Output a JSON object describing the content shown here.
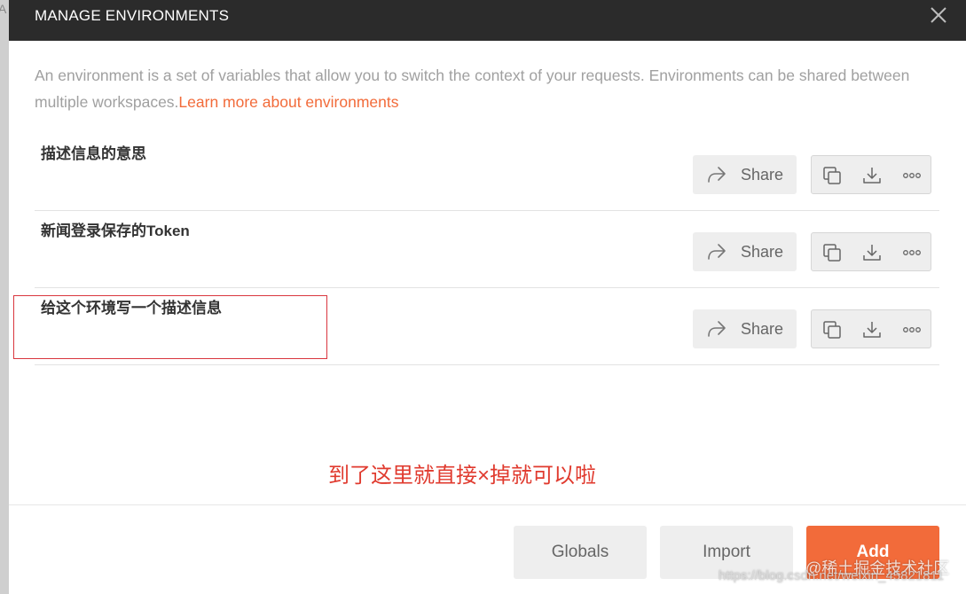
{
  "backdrop": {
    "letter": "A"
  },
  "modal": {
    "title": "MANAGE ENVIRONMENTS",
    "description_text": "An environment is a set of variables that allow you to switch the context of your requests. Environments can be shared between multiple workspaces.",
    "learn_more_link": "Learn more about environments"
  },
  "environments": [
    {
      "name": "描述信息的意思",
      "share_label": "Share"
    },
    {
      "name": "新闻登录保存的Token",
      "share_label": "Share"
    },
    {
      "name": "给这个环境写一个描述信息",
      "share_label": "Share"
    }
  ],
  "icons": {
    "close": "close-icon",
    "share": "share-arrow-icon",
    "duplicate": "duplicate-icon",
    "download": "download-icon",
    "more": "more-icon"
  },
  "annotation": "到了这里就直接×掉就可以啦",
  "footer": {
    "globals_label": "Globals",
    "import_label": "Import",
    "add_label": "Add"
  },
  "watermark": {
    "line1": "@稀土掘金技术社区",
    "line2": "https://blog.csdn.net/weixin_45821811"
  },
  "colors": {
    "header_bg": "#2b2b2b",
    "accent": "#f26b3a",
    "annotation_red": "#e03a2e",
    "button_bg": "#eeeeee"
  }
}
